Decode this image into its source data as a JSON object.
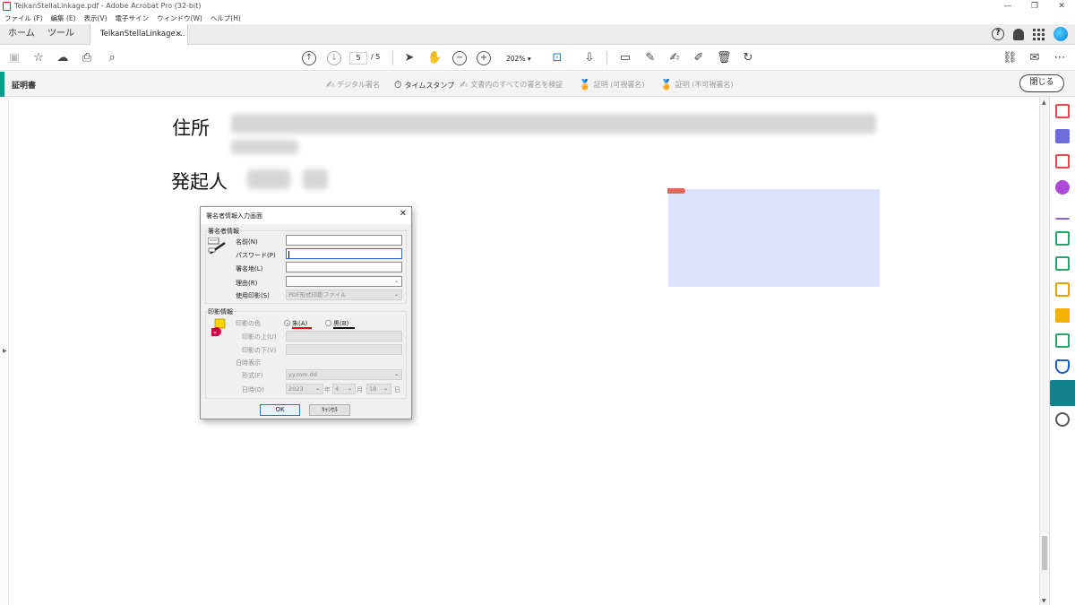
{
  "window": {
    "title": "TeikanStellaLinkage.pdf - Adobe Acrobat Pro (32-bit)",
    "controls": [
      "—",
      "❐",
      "✕"
    ]
  },
  "menu": [
    "ファイル (F)",
    "編集 (E)",
    "表示(V)",
    "電子サイン",
    "ウィンドウ(W)",
    "ヘルプ(H)"
  ],
  "tabs": {
    "home": "ホーム",
    "tools": "ツール",
    "document": "TeikanStellaLinkage....",
    "close": "×"
  },
  "toolbar": {
    "page_current": "5",
    "page_total": "/ 5",
    "zoom": "202%"
  },
  "certbar": {
    "label": "証明書",
    "digital_sign": "デジタル署名",
    "timestamp": "タイムスタンプ",
    "validate_all": "文書内のすべての署名を検証",
    "certify_visible": "証明 (可視署名)",
    "certify_invisible": "証明 (不可視署名)",
    "close": "閉じる"
  },
  "document": {
    "address_label": "住所",
    "issuer_label": "発起人"
  },
  "dialog": {
    "title": "署名者情報入力画面",
    "close": "✕",
    "signer_group": "署名者情報",
    "name_label": "名前(N)",
    "password_label": "パスワード(P)",
    "location_label": "署名地(L)",
    "reason_label": "理由(R)",
    "seal_label": "使用印影(S)",
    "seal_value": "PDF形式印影ファイル",
    "stamp_group": "印影情報",
    "color_label": "印影の色",
    "red_option": "朱(A)",
    "black_option": "黒(B)",
    "upper_label": "印影の上(U)",
    "lower_label": "印影の下(V)",
    "date_display_label": "日時表示",
    "format_label": "形式(F)",
    "format_value": "yy.mm.dd",
    "datetime_label": "日時(D)",
    "year_value": "2023",
    "year_unit": "年",
    "month_value": "4",
    "month_unit": "月",
    "day_value": "18",
    "day_unit": "日",
    "ok": "OK",
    "cancel": "ｷｬﾝｾﾙ"
  },
  "colors": {
    "accent": "#0a9a8a",
    "signature_field": "#dde2fc",
    "dialog_focus": "#2a70c8"
  }
}
